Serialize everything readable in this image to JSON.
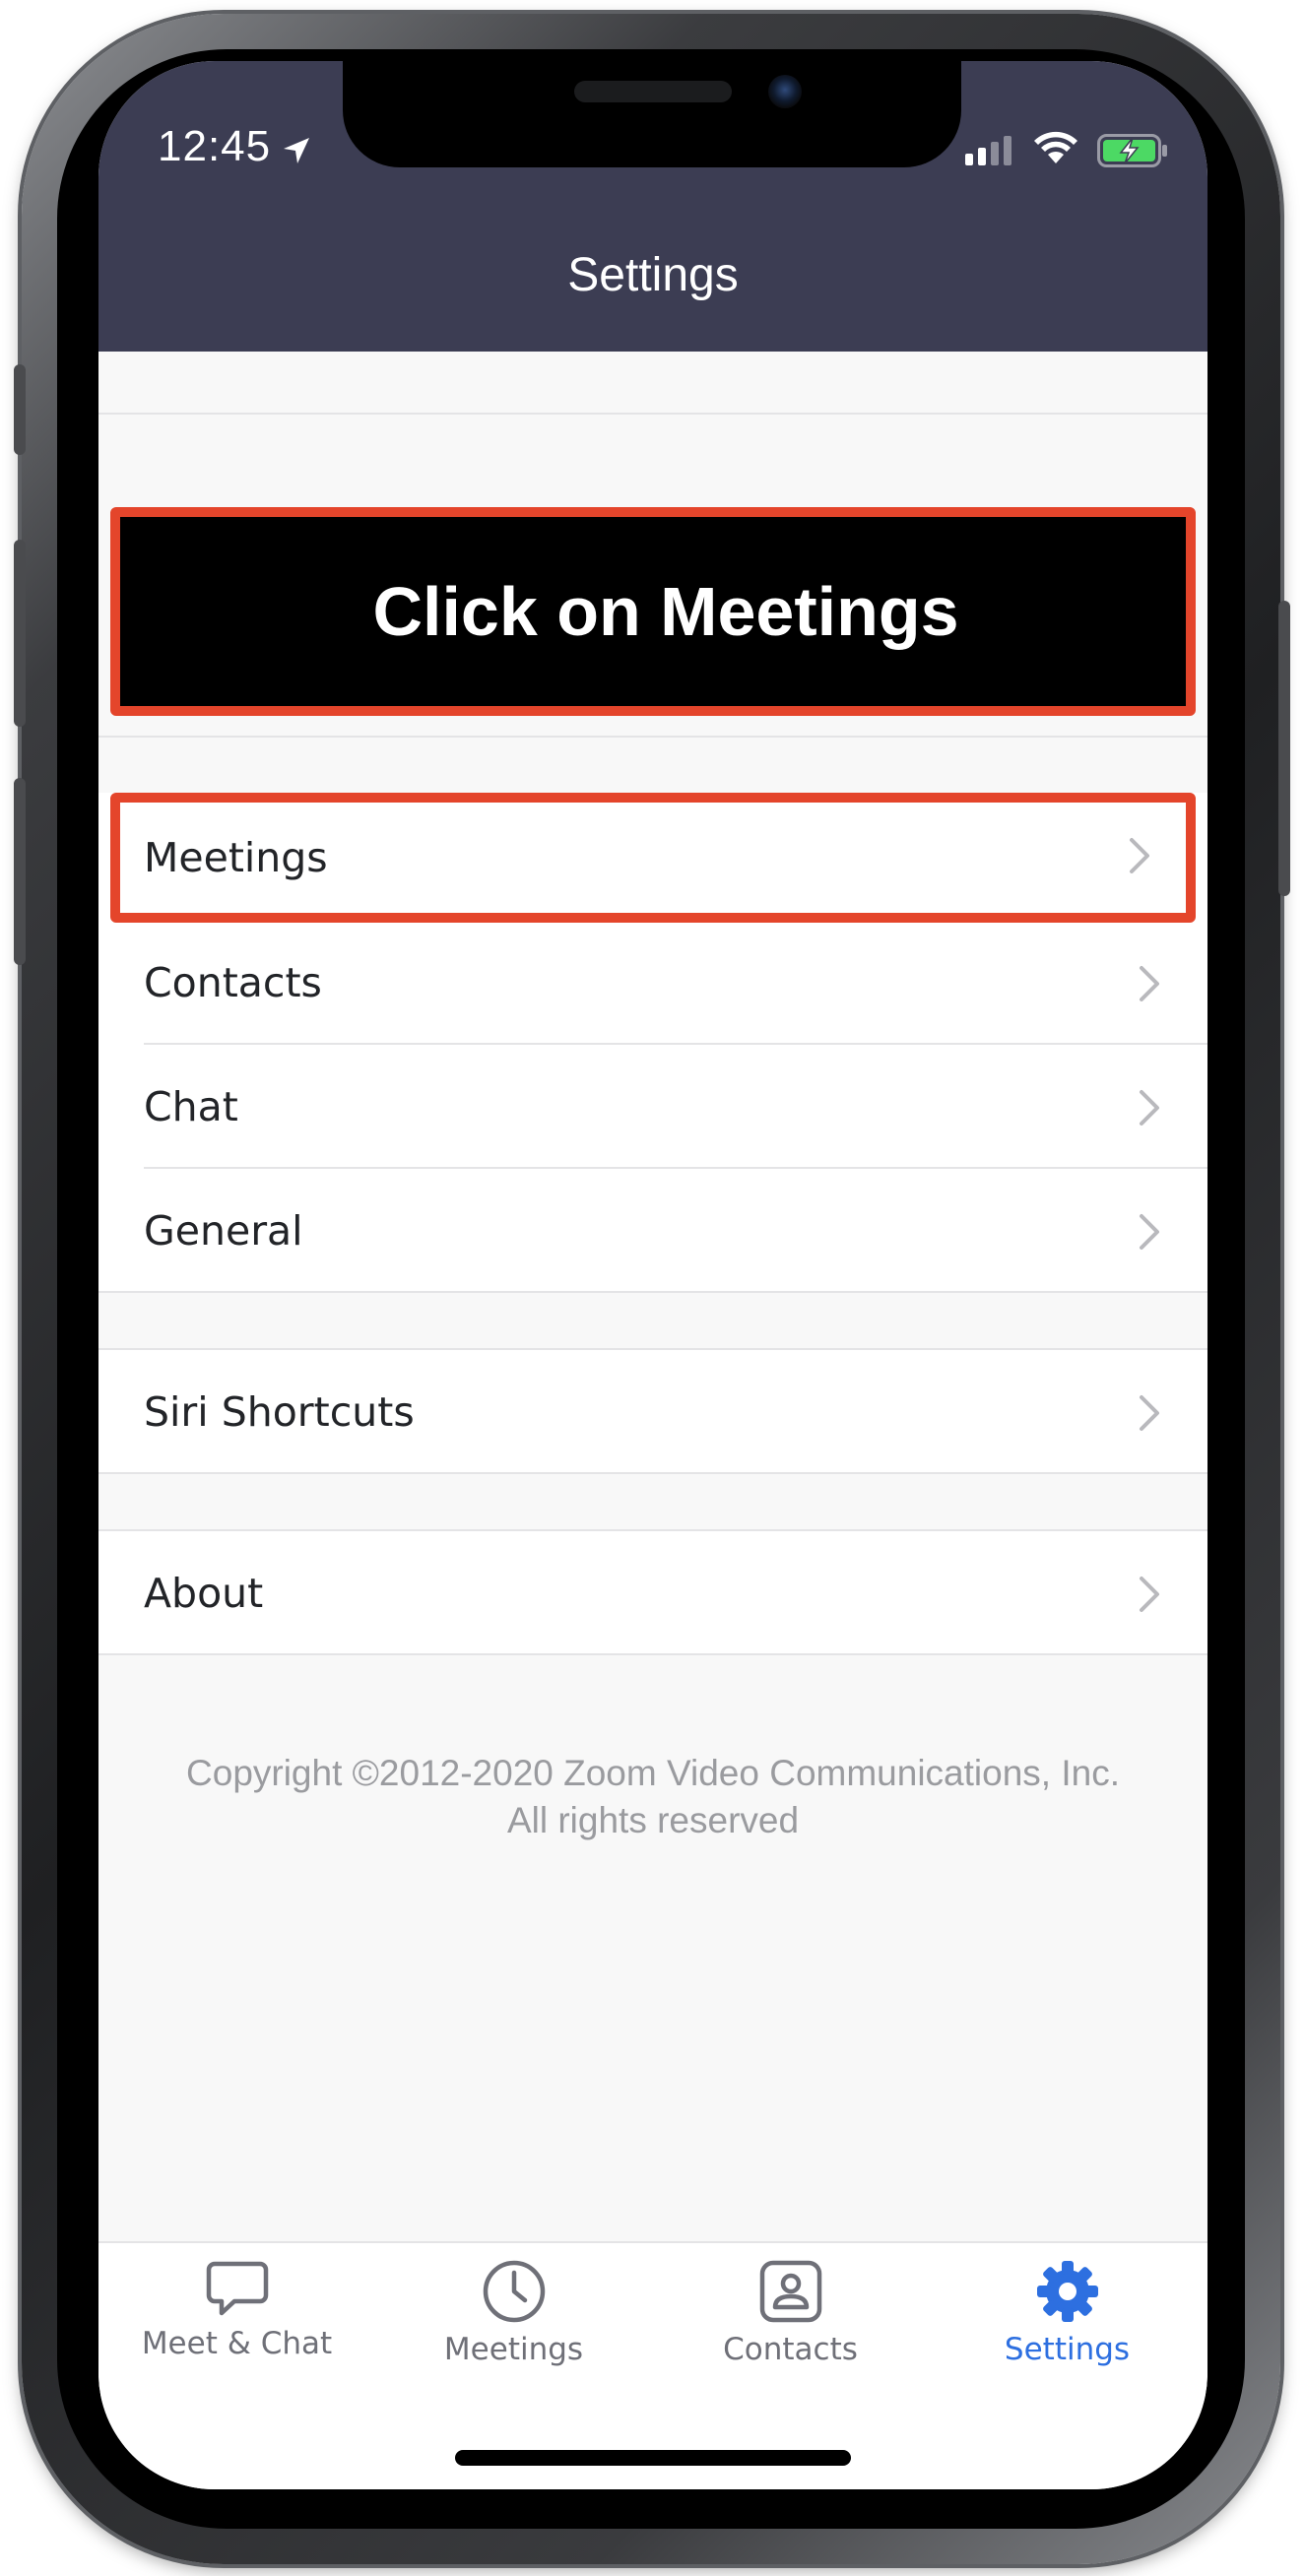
{
  "status_bar": {
    "time": "12:45",
    "icons": [
      "location-arrow-icon",
      "signal-icon",
      "wifi-icon",
      "battery-charging-icon"
    ]
  },
  "header": {
    "title": "Settings"
  },
  "instruction": {
    "text": "Click on Meetings"
  },
  "settings": {
    "group1": [
      {
        "label": "Meetings"
      },
      {
        "label": "Contacts"
      },
      {
        "label": "Chat"
      },
      {
        "label": "General"
      }
    ],
    "group2": [
      {
        "label": "Siri Shortcuts"
      }
    ],
    "group3": [
      {
        "label": "About"
      }
    ]
  },
  "copyright": {
    "line1": "Copyright ©2012-2020 Zoom Video Communications, Inc.",
    "line2": "All rights reserved"
  },
  "tabbar": {
    "tabs": [
      {
        "label": "Meet & Chat",
        "icon": "chat-bubble-icon",
        "active": false
      },
      {
        "label": "Meetings",
        "icon": "clock-icon",
        "active": false
      },
      {
        "label": "Contacts",
        "icon": "contact-card-icon",
        "active": false
      },
      {
        "label": "Settings",
        "icon": "gear-icon",
        "active": true
      }
    ]
  },
  "colors": {
    "header_bg": "#3c3d53",
    "highlight_border": "#e4452b",
    "active_tab": "#2d6fe0",
    "inactive_tab": "#6f7078",
    "battery_green": "#4cd964"
  }
}
